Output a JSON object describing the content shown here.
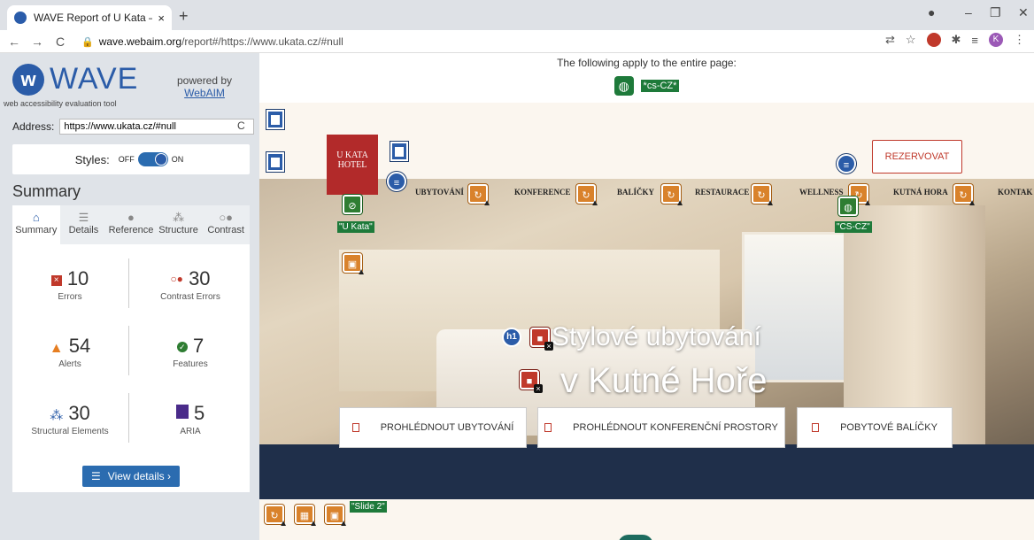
{
  "browser": {
    "tab_title": "WAVE Report of U Kata – Hotel U",
    "url_host": "wave.webaim.org",
    "url_path": "/report#/https://www.ukata.cz/#null",
    "profile_initial": "K"
  },
  "wave": {
    "logo_text": "WAVE",
    "logo_sub": "web accessibility evaluation tool",
    "powered_by": "powered by",
    "webaim_link": "WebAIM",
    "address_label": "Address:",
    "address_value": "https://www.ukata.cz/#null",
    "styles_label": "Styles:",
    "styles_off": "OFF",
    "styles_on": "ON",
    "summary_title": "Summary",
    "tabs": [
      {
        "label": "Summary",
        "icon": "home-icon"
      },
      {
        "label": "Details",
        "icon": "list-icon"
      },
      {
        "label": "Reference",
        "icon": "info-icon"
      },
      {
        "label": "Structure",
        "icon": "hierarchy-icon"
      },
      {
        "label": "Contrast",
        "icon": "contrast-icon"
      }
    ],
    "stats": {
      "errors": {
        "value": "10",
        "label": "Errors"
      },
      "contrast": {
        "value": "30",
        "label": "Contrast Errors"
      },
      "alerts": {
        "value": "54",
        "label": "Alerts"
      },
      "features": {
        "value": "7",
        "label": "Features"
      },
      "structure": {
        "value": "30",
        "label": "Structural Elements"
      },
      "aria": {
        "value": "5",
        "label": "ARIA"
      }
    },
    "view_details": "View details ›"
  },
  "page": {
    "note": "The following apply to the entire page:",
    "lang_label": "*cs-CZ*",
    "rezervovat": "REZERVOVAT",
    "logo_line1": "U KATA",
    "logo_line2": "HOTEL",
    "nav": [
      "UBYTOVÁNÍ",
      "KONFERENCE",
      "BALÍČKY",
      "RESTAURACE",
      "WELLNESS",
      "KUTNÁ HORA",
      "KONTAK"
    ],
    "hero_line1": "Stylové ubytování",
    "hero_line2": "v Kutné Hoře",
    "cta": [
      "PROHLÉDNOUT UBYTOVÁNÍ",
      "PROHLÉDNOUT KONFERENČNÍ PROSTORY",
      "POBYTOVÉ BALÍČKY"
    ],
    "label_ukata": "\"U Kata\"",
    "label_cs": "\"CS-CZ\"",
    "label_slide": "\"Slide 2\"",
    "h1_badge": "h1"
  }
}
